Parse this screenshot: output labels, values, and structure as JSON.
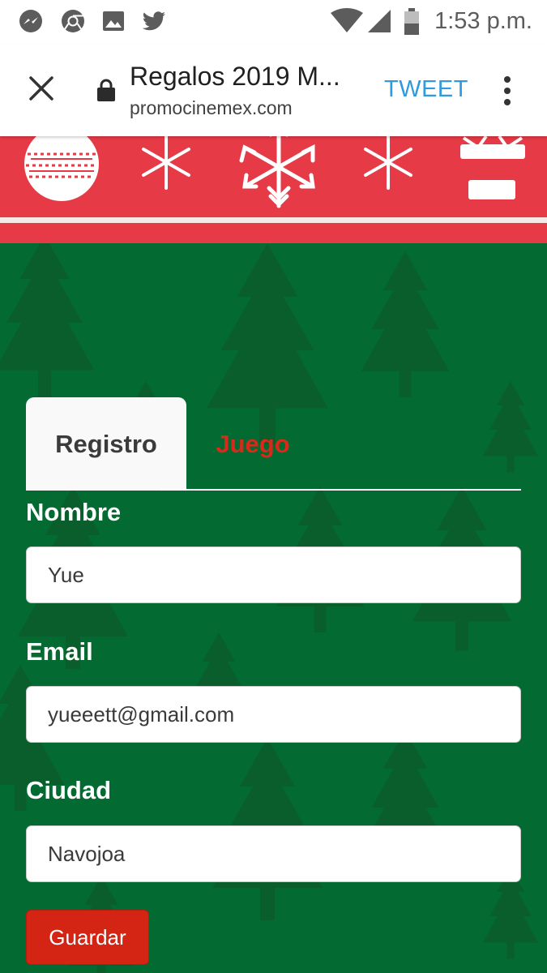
{
  "status_bar": {
    "time": "1:53 p.m.",
    "left_icons": [
      "messenger-icon",
      "chrome-icon",
      "image-icon",
      "twitter-icon"
    ],
    "right_icons": [
      "wifi-icon",
      "signal-icon",
      "battery-icon"
    ]
  },
  "browser": {
    "title": "Regalos 2019 M...",
    "url": "promocinemex.com",
    "tweet_label": "TWEET",
    "icons": [
      "close-icon",
      "lock-icon",
      "more-vert-icon"
    ]
  },
  "banner": {
    "icons": [
      "ornament-icon",
      "snowflake-icon",
      "snowflake-icon",
      "snowflake-icon",
      "gift-box-icon"
    ]
  },
  "tabs": [
    {
      "label": "Registro",
      "active": true
    },
    {
      "label": "Juego",
      "active": false
    }
  ],
  "form": {
    "name_label": "Nombre",
    "name_value": "Yue",
    "email_label": "Email",
    "email_value": "yueeett@gmail.com",
    "city_label": "Ciudad",
    "city_value": "Navojoa",
    "save_label": "Guardar"
  },
  "colors": {
    "banner_red": "#e63a46",
    "main_green": "#036a32",
    "tree_green": "#0a5e2b",
    "tweet_blue": "#2f9ae0",
    "accent_red": "#d32414"
  }
}
